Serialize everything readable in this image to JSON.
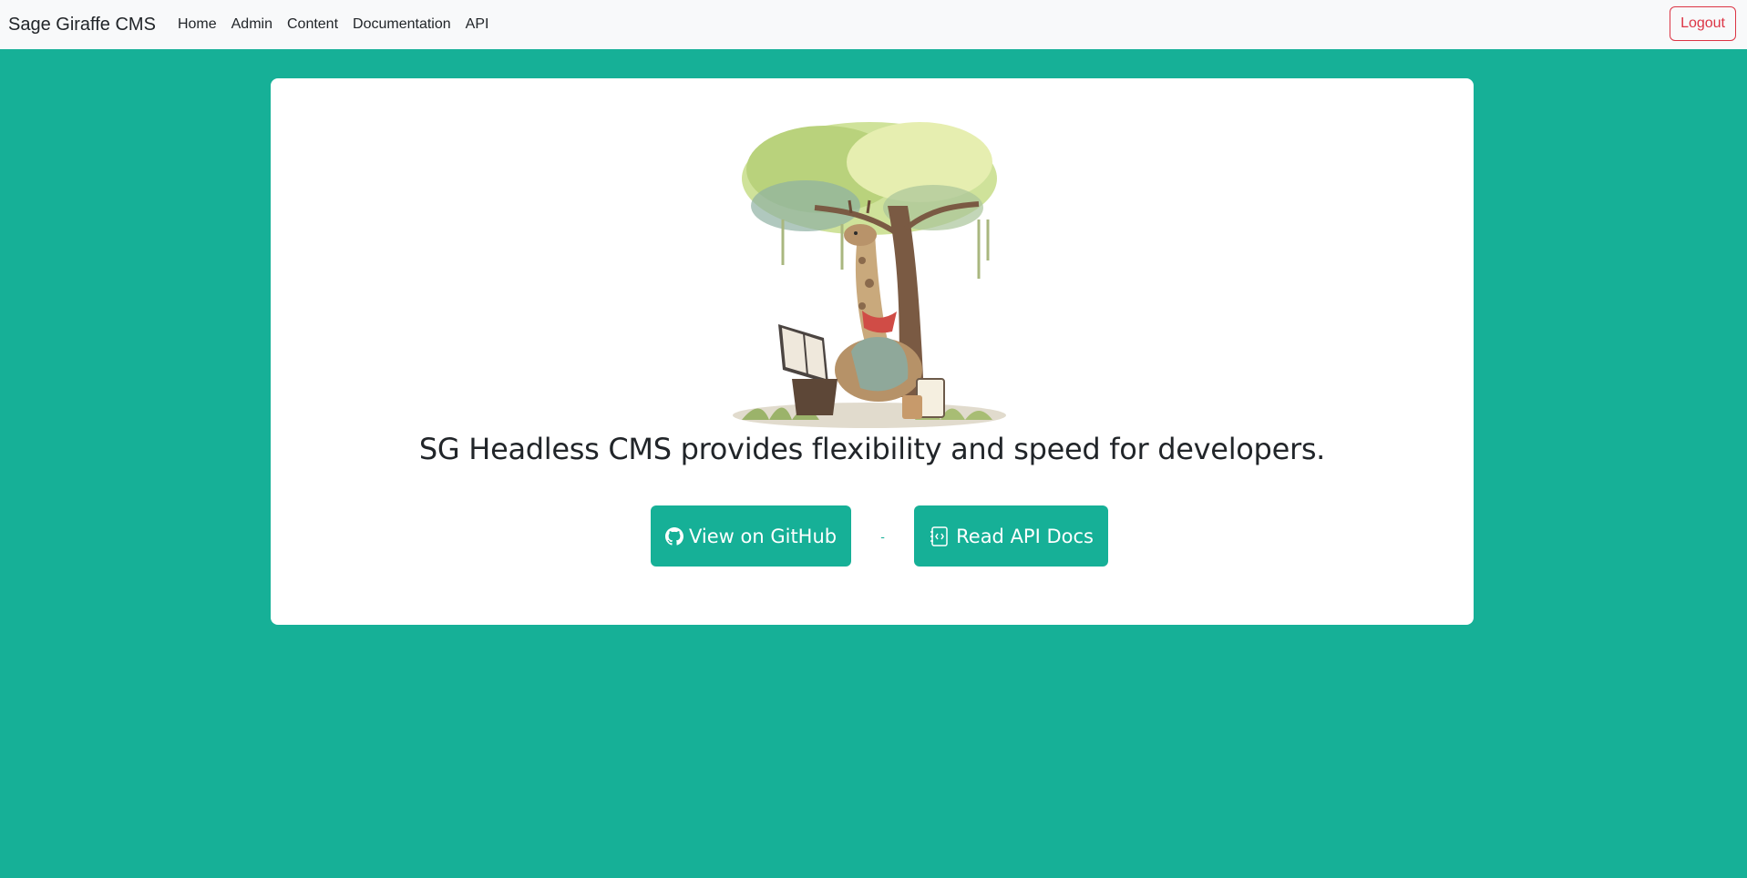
{
  "navbar": {
    "brand": "Sage Giraffe CMS",
    "links": [
      "Home",
      "Admin",
      "Content",
      "Documentation",
      "API"
    ],
    "logout_label": "Logout"
  },
  "hero": {
    "tagline": "SG Headless CMS provides flexibility and speed for developers.",
    "github_button": "View on GitHub",
    "separator": "-",
    "api_docs_button": "Read API Docs"
  },
  "colors": {
    "background": "#16b097",
    "navbar": "#f8f9fa",
    "danger": "#dc3545",
    "button": "#16b097"
  }
}
